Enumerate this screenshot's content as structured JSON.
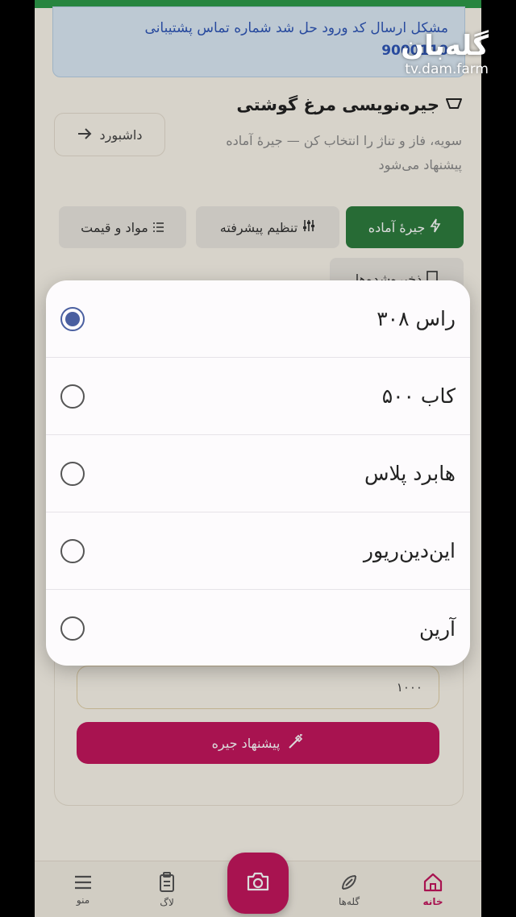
{
  "notice": {
    "line1": "مشکل ارسال کد ورود حل شد شماره تماس پشتیبانی",
    "line2": "9000110"
  },
  "header": {
    "title": "جیره‌نویسی مرغ گوشتی",
    "subtitle": "سویه، فاز و تناژ را انتخاب کن — جیرهٔ آماده پیشنهاد می‌شود",
    "dashboard_label": "داشبورد"
  },
  "tabs": {
    "ready": "جیرهٔ آماده",
    "advanced": "تنظیم پیشرفته",
    "materials": "مواد و قیمت",
    "saved": "ذخیره‌شده‌ها"
  },
  "form": {
    "quantity_value": "۱۰۰۰",
    "suggest_label": "پیشنهاد جیره"
  },
  "strain_dialog": {
    "options": [
      {
        "label": "راس ۳۰۸",
        "selected": true
      },
      {
        "label": "کاب ۵۰۰",
        "selected": false
      },
      {
        "label": "هابرد پلاس",
        "selected": false
      },
      {
        "label": "این‌دین‌ریور",
        "selected": false
      },
      {
        "label": "آرین",
        "selected": false
      }
    ]
  },
  "bottom_nav": {
    "home": "خانه",
    "herds": "گله‌ها",
    "log": "لاگ",
    "menu": "منو"
  },
  "watermark": {
    "logo": "گله‌بان",
    "domain": "tv.dam.farm"
  },
  "colors": {
    "primary_green": "#2e7d3e",
    "accent_magenta": "#c4175e",
    "radio_blue": "#4a5fa0"
  }
}
